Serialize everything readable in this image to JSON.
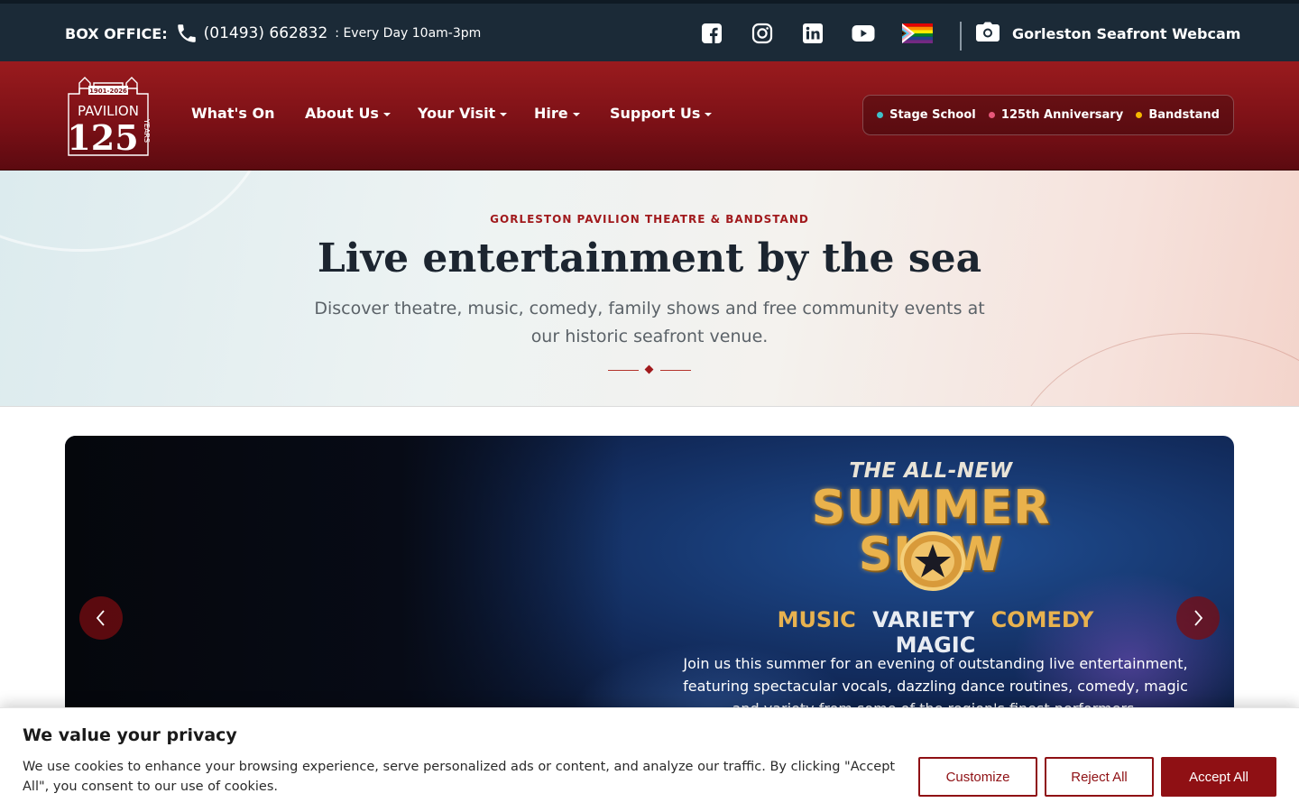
{
  "topbar": {
    "box_office_label": "BOX OFFICE:",
    "phone": "(01493) 662832",
    "hours": ": Every Day 10am-3pm",
    "social_icons": [
      "facebook-icon",
      "instagram-icon",
      "linkedin-icon",
      "youtube-icon",
      "pride-flag-icon"
    ],
    "webcam_label": "Gorleston Seafront Webcam"
  },
  "logo": {
    "years": "1901-2026",
    "name": "PAVILION",
    "number": "125",
    "suffix": "YEARS"
  },
  "nav": {
    "items": [
      {
        "label": "What's On",
        "dropdown": false
      },
      {
        "label": "About Us",
        "dropdown": true
      },
      {
        "label": "Your Visit",
        "dropdown": true
      },
      {
        "label": "Hire",
        "dropdown": true
      },
      {
        "label": "Support Us",
        "dropdown": true
      }
    ]
  },
  "quick_links": [
    {
      "label": "Stage School",
      "color": "#3fc1c9"
    },
    {
      "label": "125th Anniversary",
      "color": "#e8577a"
    },
    {
      "label": "Bandstand",
      "color": "#f5b800"
    }
  ],
  "hero": {
    "eyebrow": "GORLESTON PAVILION THEATRE & BANDSTAND",
    "title": "Live entertainment by the sea",
    "subtitle": "Discover theatre, music, comedy, family shows and free community events at our historic seafront venue."
  },
  "carousel": {
    "kicker": "THE ALL-NEW",
    "show_line1": "SUMMER",
    "show_line2": "SH   W",
    "genres": [
      {
        "label": "MUSIC",
        "tone": "gold"
      },
      {
        "label": "VARIETY",
        "tone": "white"
      },
      {
        "label": "COMEDY",
        "tone": "gold"
      },
      {
        "label": "MAGIC",
        "tone": "white"
      }
    ],
    "description": "Join us this summer for an evening of outstanding live entertainment, featuring spectacular vocals, dazzling dance routines, comedy, magic and variety from some of the region's finest performers."
  },
  "cookie": {
    "title": "We value your privacy",
    "text": "We use cookies to enhance your browsing experience, serve personalized ads or content, and analyze our traffic. By clicking \"Accept All\", you consent to our use of cookies.",
    "customize": "Customize",
    "reject": "Reject All",
    "accept": "Accept All"
  },
  "colors": {
    "brand_red": "#8f1014",
    "topbar": "#1b2a37"
  }
}
